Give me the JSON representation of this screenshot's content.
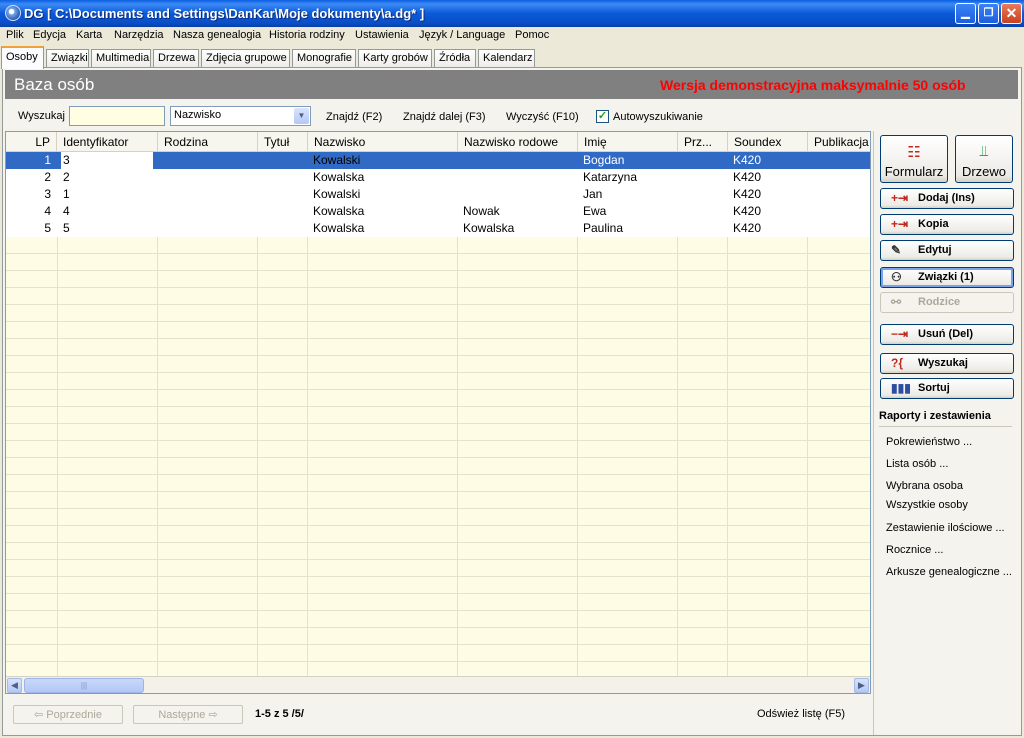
{
  "window": {
    "title": "DG [ C:\\Documents and Settings\\DanKar\\Moje dokumenty\\a.dg* ]"
  },
  "menu": [
    "Plik",
    "Edycja",
    "Karta",
    "Narzędzia",
    "Nasza genealogia",
    "Historia rodziny",
    "Ustawienia",
    "Język / Language",
    "Pomoc"
  ],
  "tabs": [
    "Osoby",
    "Związki",
    "Multimedia",
    "Drzewa",
    "Zdjęcia grupowe",
    "Monografie",
    "Karty grobów",
    "Źródła",
    "Kalendarz"
  ],
  "header": {
    "title": "Baza osób",
    "demo_notice": "Wersja demonstracyjna maksymalnie 50 osób"
  },
  "search": {
    "label": "Wyszukaj",
    "value": "",
    "field_select": "Nazwisko",
    "find": "Znajdź (F2)",
    "find_next": "Znajdź dalej (F3)",
    "clear": "Wyczyść (F10)",
    "autosearch_label": "Autowyszukiwanie",
    "autosearch_checked": true
  },
  "table": {
    "columns": [
      "LP",
      "Identyfikator",
      "Rodzina",
      "Tytuł",
      "Nazwisko",
      "Nazwisko rodowe",
      "Imię",
      "Prz...",
      "Soundex",
      "Publikacja"
    ],
    "rows": [
      [
        "1",
        "3",
        "",
        "",
        "Kowalski",
        "",
        "Bogdan",
        "",
        "K420",
        ""
      ],
      [
        "2",
        "2",
        "",
        "",
        "Kowalska",
        "",
        "Katarzyna",
        "",
        "K420",
        ""
      ],
      [
        "3",
        "1",
        "",
        "",
        "Kowalski",
        "",
        "Jan",
        "",
        "K420",
        ""
      ],
      [
        "4",
        "4",
        "",
        "",
        "Kowalska",
        "Nowak",
        "Ewa",
        "",
        "K420",
        ""
      ],
      [
        "5",
        "5",
        "",
        "",
        "Kowalska",
        "Kowalska",
        "Paulina",
        "",
        "K420",
        ""
      ]
    ],
    "selected_row": 0
  },
  "footer": {
    "prev": "⇦ Poprzednie",
    "next": "Następne ⇨",
    "counter": "1-5 z 5 /5/",
    "refresh": "Odśwież listę (F5)"
  },
  "actions": {
    "form": "Formularz",
    "tree": "Drzewo",
    "add": "Dodaj  (Ins)",
    "copy": "Kopia",
    "edit": "Edytuj",
    "relations": "Związki (1)",
    "parents": "Rodzice",
    "delete": "Usuń  (Del)",
    "search": "Wyszukaj",
    "sort": "Sortuj"
  },
  "reports": {
    "title": "Raporty i zestawienia",
    "items": [
      "Pokrewieństwo ...",
      "Lista osób ...",
      "Wybrana osoba",
      "Wszystkie osoby",
      "Zestawienie ilościowe ...",
      "Rocznice ...",
      "Arkusze genealogiczne ..."
    ]
  }
}
